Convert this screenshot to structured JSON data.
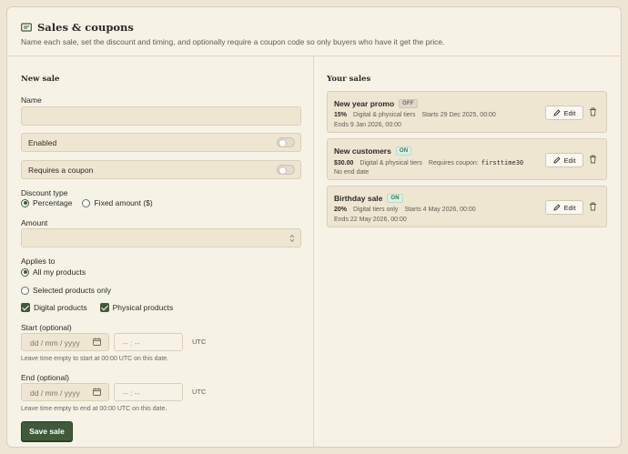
{
  "header": {
    "title": "Sales & coupons",
    "description": "Name each sale, set the discount and timing, and optionally require a coupon code so only buyers who have it get the price."
  },
  "form": {
    "section_title": "New sale",
    "name_label": "Name",
    "name_value": "",
    "enabled_label": "Enabled",
    "enabled": false,
    "coupon_label": "Requires a coupon",
    "coupon": false,
    "discount_type_label": "Discount type",
    "discount_options": [
      "Percentage",
      "Fixed amount ($)"
    ],
    "discount_selected": "Percentage",
    "amount_label": "Amount",
    "amount_value": "",
    "applies_to_label": "Applies to",
    "applies_options": [
      "All my products",
      "Selected products only"
    ],
    "applies_selected": "All my products",
    "product_types": [
      {
        "label": "Digital products",
        "checked": true
      },
      {
        "label": "Physical products",
        "checked": true
      }
    ],
    "start_label": "Start (optional)",
    "start_date_placeholder": "dd / mm / yyyy",
    "start_time_placeholder": "-- : --",
    "start_tz": "UTC",
    "start_hint": "Leave time empty to start at 00:00 UTC on this date.",
    "end_label": "End (optional)",
    "end_date_placeholder": "dd / mm / yyyy",
    "end_time_placeholder": "-- : --",
    "end_tz": "UTC",
    "end_hint": "Leave time empty to end at 00:00 UTC on this date.",
    "save_label": "Save sale"
  },
  "sales": {
    "section_title": "Your sales",
    "edit_label": "Edit",
    "items": [
      {
        "name": "New year promo",
        "status": "OFF",
        "discount": "15%",
        "scope": "Digital & physical tiers",
        "starts": "Starts 29 Dec 2025, 00:00",
        "ends": "Ends 9 Jan 2026, 00:00"
      },
      {
        "name": "New customers",
        "status": "ON",
        "discount": "$30.00",
        "scope": "Digital & physical tiers",
        "coupon_label": "Requires coupon:",
        "coupon_code": "firsttime30",
        "ends": "No end date"
      },
      {
        "name": "Birthday sale",
        "status": "ON",
        "discount": "20%",
        "scope": "Digital tiers only",
        "starts": "Starts 4 May 2026, 00:00",
        "ends": "Ends 22 May 2026, 00:00"
      }
    ]
  },
  "colors": {
    "accent": "#3f5a3a",
    "background": "#ede6d4",
    "card": "#f7f2e6",
    "field": "#efe6d2",
    "status_on": "#2e7a58"
  }
}
